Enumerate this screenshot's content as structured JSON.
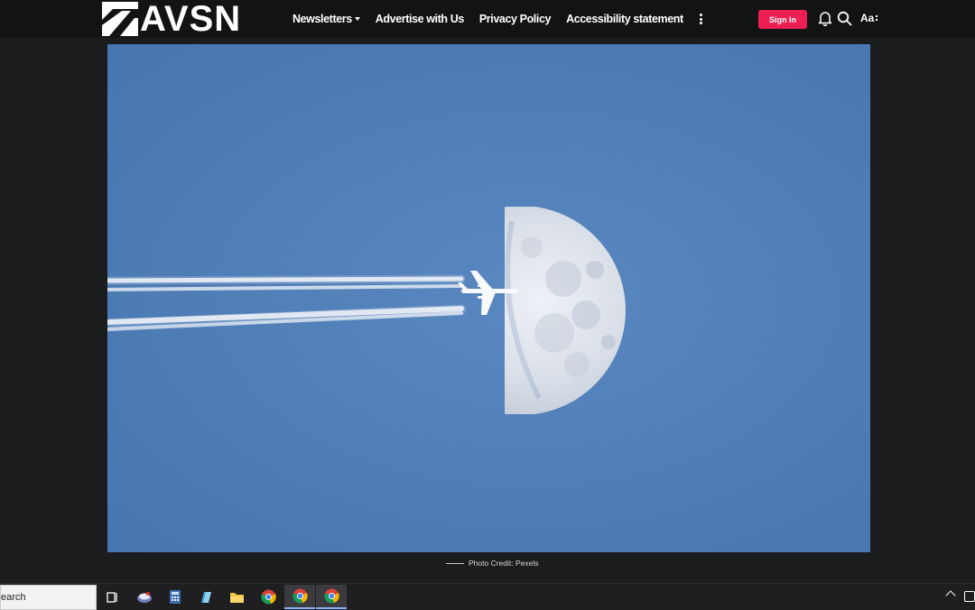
{
  "site": {
    "logo_text": "AVSN"
  },
  "nav": {
    "items": [
      {
        "label": "Newsletters",
        "has_caret": true
      },
      {
        "label": "Advertise with Us"
      },
      {
        "label": "Privacy Policy"
      },
      {
        "label": "Accessibility statement"
      }
    ]
  },
  "header_actions": {
    "signin_label": "Sign In",
    "font_size_label": "Aa",
    "icons": [
      "bell-icon",
      "search-icon",
      "more-vertical-icon"
    ]
  },
  "article": {
    "photo_credit": "Photo Credit: Pexels"
  },
  "taskbar": {
    "search_text": "earch",
    "icons": [
      "task-view-icon",
      "app-icon",
      "calculator-icon",
      "notepad-icon",
      "file-explorer-icon",
      "chrome-icon",
      "chrome-icon",
      "chrome-icon"
    ]
  },
  "colors": {
    "accent": "#ee1f53",
    "header_bg": "#121314",
    "page_bg": "#1b1c1e",
    "sky": "#4f7db6"
  }
}
